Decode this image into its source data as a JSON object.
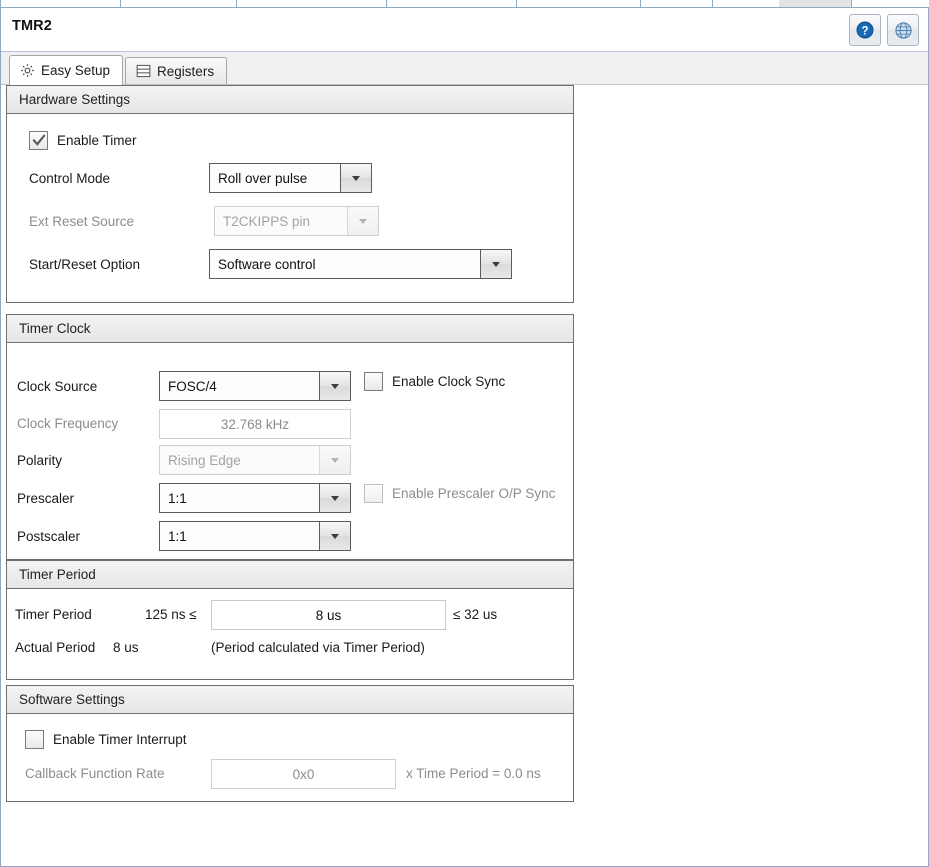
{
  "window": {
    "title": "TMR2",
    "help_button": "help-icon",
    "globe_button": "globe-icon"
  },
  "tabs": [
    {
      "label": "Easy Setup",
      "icon": "gear-icon",
      "active": true
    },
    {
      "label": "Registers",
      "icon": "registers-icon",
      "active": false
    }
  ],
  "sections": {
    "hardware": {
      "title": "Hardware Settings",
      "enable_timer": {
        "label": "Enable Timer",
        "checked": true
      },
      "control_mode": {
        "label": "Control Mode",
        "value": "Roll over pulse",
        "enabled": true
      },
      "ext_reset_source": {
        "label": "Ext Reset Source",
        "value": "T2CKIPPS pin",
        "enabled": false
      },
      "start_reset_option": {
        "label": "Start/Reset Option",
        "value": "Software control",
        "enabled": true
      }
    },
    "timer_clock": {
      "title": "Timer Clock",
      "clock_source": {
        "label": "Clock Source",
        "value": "FOSC/4",
        "enabled": true
      },
      "enable_clock_sync": {
        "label": "Enable Clock Sync",
        "checked": false,
        "enabled": true
      },
      "clock_frequency": {
        "label": "Clock Frequency",
        "value": "32.768 kHz",
        "enabled": false
      },
      "polarity": {
        "label": "Polarity",
        "value": "Rising Edge",
        "enabled": false
      },
      "prescaler": {
        "label": "Prescaler",
        "value": "1:1",
        "enabled": true
      },
      "enable_prescaler_sync": {
        "label": "Enable Prescaler O/P Sync",
        "checked": false,
        "enabled": false
      },
      "postscaler": {
        "label": "Postscaler",
        "value": "1:1",
        "enabled": true
      }
    },
    "timer_period": {
      "title": "Timer Period",
      "period_label": "Timer Period",
      "min_text": "125 ns ≤",
      "period_value": "8 us",
      "max_text": "≤ 32 us",
      "actual_label": "Actual Period",
      "actual_value": "8 us",
      "note": "(Period calculated via Timer Period)"
    },
    "software": {
      "title": "Software Settings",
      "enable_interrupt": {
        "label": "Enable Timer Interrupt",
        "checked": false
      },
      "callback_label": "Callback Function Rate",
      "callback_value": "0x0",
      "callback_suffix": "x Time Period = 0.0 ns"
    }
  },
  "colors": {
    "accent_blue": "#1769b5",
    "frame_blue": "#8fa8c8",
    "group_border": "#6f6f6f",
    "disabled_text": "#8c8c8c"
  }
}
